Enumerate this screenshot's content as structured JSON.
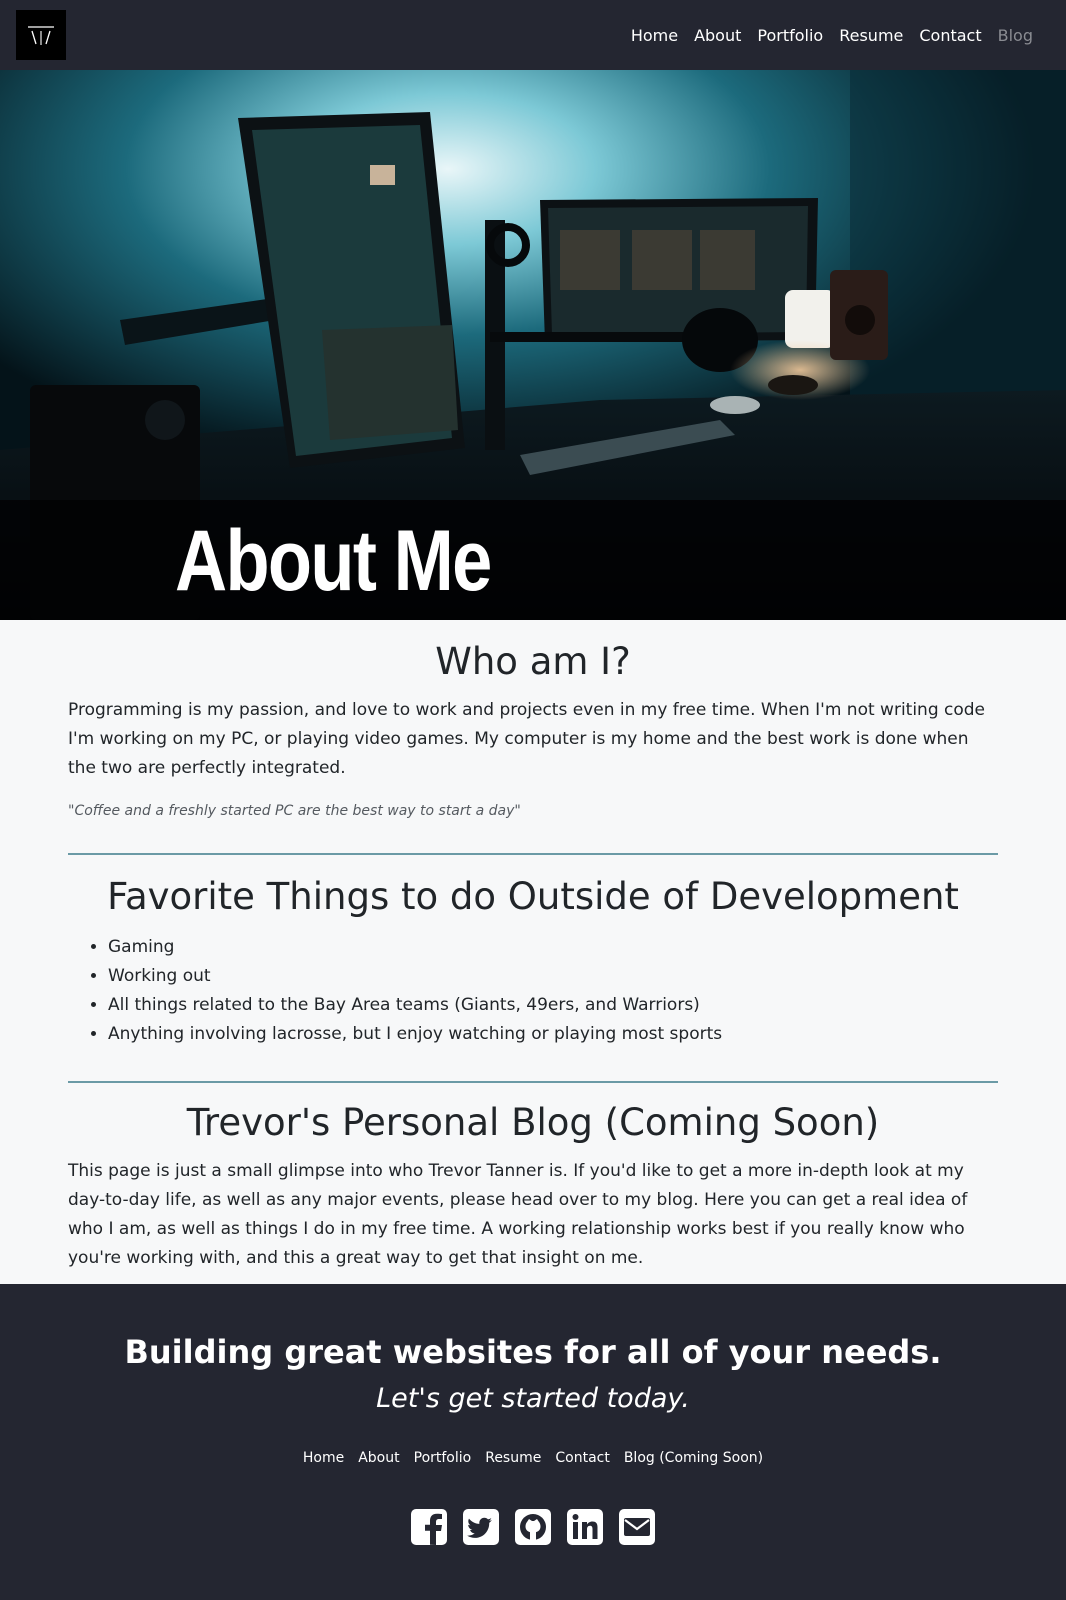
{
  "nav": {
    "items": [
      {
        "label": "Home"
      },
      {
        "label": "About"
      },
      {
        "label": "Portfolio"
      },
      {
        "label": "Resume"
      },
      {
        "label": "Contact"
      },
      {
        "label": "Blog"
      }
    ]
  },
  "hero": {
    "title": "About Me"
  },
  "who": {
    "title": "Who am I?",
    "paragraph": "Programming is my passion, and love to work and projects even in my free time. When I'm not writing code I'm working on my PC, or playing video games. My computer is my home and the best work is done when the two are perfectly integrated.",
    "quote": "\"Coffee and a freshly started PC are the best way to start a day\""
  },
  "favorites": {
    "title": "Favorite Things to do Outside of Development",
    "items": [
      "Gaming",
      "Working out",
      "All things related to the Bay Area teams (Giants, 49ers, and Warriors)",
      "Anything involving lacrosse, but I enjoy watching or playing most sports"
    ]
  },
  "blog": {
    "title": "Trevor's Personal Blog (Coming Soon)",
    "paragraph": "This page is just a small glimpse into who Trevor Tanner is. If you'd like to get a more in-depth look at my day-to-day life, as well as any major events, please head over to my blog. Here you can get a real idea of who I am, as well as things I do in my free time. A working relationship works best if you really know who you're working with, and this a great way to get that insight on me."
  },
  "footer": {
    "headline": "Building great websites for all of your needs.",
    "subline": "Let's get started today.",
    "links": [
      {
        "label": "Home"
      },
      {
        "label": "About"
      },
      {
        "label": "Portfolio"
      },
      {
        "label": "Resume"
      },
      {
        "label": "Contact"
      },
      {
        "label": "Blog (Coming Soon)"
      }
    ],
    "social": [
      "facebook-icon",
      "twitter-icon",
      "github-icon",
      "linkedin-icon",
      "envelope-icon"
    ]
  },
  "colors": {
    "navbar_bg": "#242631",
    "footer_bg": "#242631",
    "divider": "#6b9aa6",
    "page_bg": "#f7f8f9",
    "muted_link": "#8a8c92"
  }
}
